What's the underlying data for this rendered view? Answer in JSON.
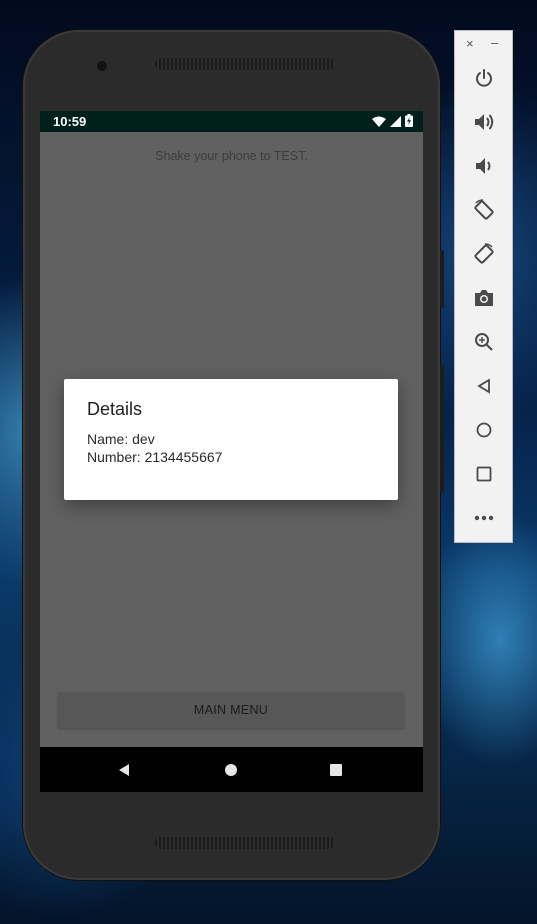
{
  "status_bar": {
    "time": "10:59",
    "icons": [
      "wifi-icon",
      "signal-icon",
      "battery-charging-icon"
    ]
  },
  "app": {
    "hint": "Shake your phone to TEST.",
    "main_menu_label": "MAIN MENU"
  },
  "dialog": {
    "title": "Details",
    "name_line": "Name: dev",
    "number_line": "Number: 2134455667"
  },
  "navigation_bar": [
    "back-icon",
    "home-icon",
    "recents-icon"
  ],
  "emulator_toolbar": {
    "window_controls": {
      "close": "×",
      "minimize": "–"
    },
    "items": [
      "power-icon",
      "volume-up-icon",
      "volume-down-icon",
      "rotate-left-icon",
      "rotate-right-icon",
      "camera-icon",
      "zoom-icon",
      "back-icon",
      "home-icon",
      "overview-icon",
      "more-icon"
    ]
  },
  "colors": {
    "screen_dim": "#616161",
    "status_bar": "#00201a",
    "dialog_bg": "#ffffff",
    "nav_bar": "#000000",
    "toolbar_bg": "#f2f2f2"
  }
}
